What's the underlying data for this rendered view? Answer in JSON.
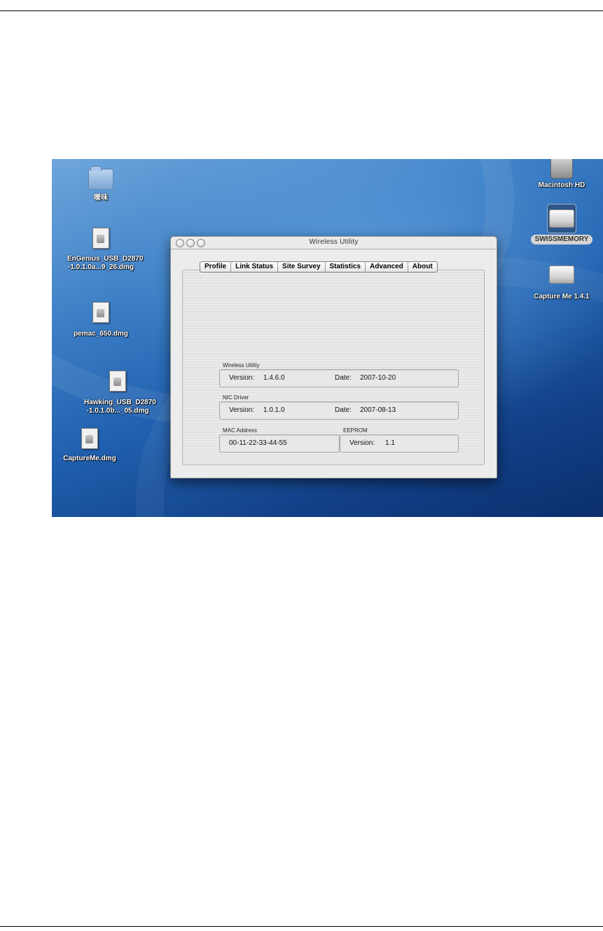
{
  "desktop": {
    "icons": [
      {
        "label": "暖味"
      },
      {
        "label": "EnGenius_USB_D2870 -1.0.1.0a...9_26.dmg"
      },
      {
        "label": "pemac_650.dmg"
      },
      {
        "label": "Hawking_USB_D2870 -1.0.1.0b..._05.dmg"
      },
      {
        "label": "CaptureMe.dmg"
      },
      {
        "label": "Macintosh HD"
      },
      {
        "label": "SWISSMEMORY"
      },
      {
        "label": "Capture Me 1.4.1"
      }
    ]
  },
  "window": {
    "title": "Wireless Utility",
    "tabs": [
      "Profile",
      "Link Status",
      "Site Survey",
      "Statistics",
      "Advanced",
      "About"
    ],
    "about": {
      "wireless_utility": {
        "group_label": "Wireless Utility",
        "version_label": "Version:",
        "version": "1.4.6.0",
        "date_label": "Date:",
        "date": "2007-10-20"
      },
      "nic_driver": {
        "group_label": "NIC Driver",
        "version_label": "Version:",
        "version": "1.0.1.0",
        "date_label": "Date:",
        "date": "2007-08-13"
      },
      "mac_address": {
        "group_label": "MAC Address",
        "value": "00-11-22-33-44-55"
      },
      "eeprom": {
        "group_label": "EEPROM",
        "version_label": "Version:",
        "version": "1.1"
      }
    }
  }
}
